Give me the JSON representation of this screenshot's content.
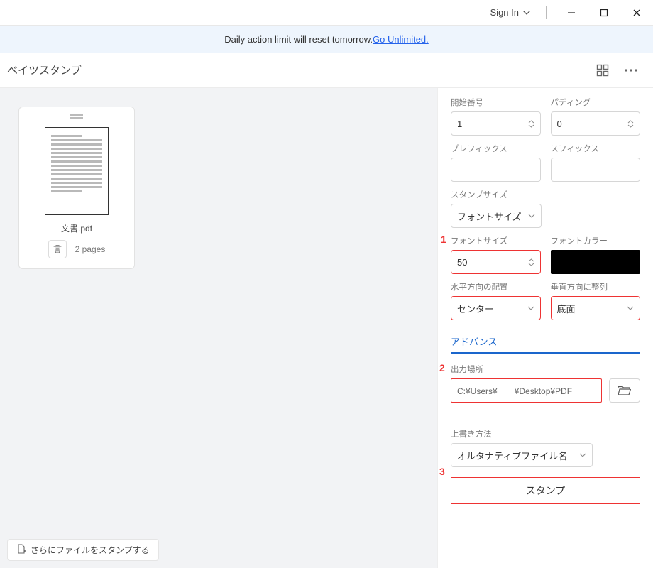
{
  "titlebar": {
    "signin": "Sign In"
  },
  "banner": {
    "text": "Daily action limit will reset tomorrow. ",
    "link": "Go Unlimited."
  },
  "header": {
    "title": "ベイツスタンプ"
  },
  "file": {
    "name": "文書.pdf",
    "pages": "2 pages"
  },
  "panel": {
    "start_number": {
      "label": "開始番号",
      "value": "1"
    },
    "padding": {
      "label": "パディング",
      "value": "0"
    },
    "prefix": {
      "label": "プレフィックス",
      "value": ""
    },
    "suffix": {
      "label": "スフィックス",
      "value": ""
    },
    "stamp_size": {
      "label": "スタンプサイズ",
      "value": "フォントサイズ"
    },
    "font_size": {
      "label": "フォントサイズ",
      "value": "50"
    },
    "font_color": {
      "label": "フォントカラー",
      "value": "#000000"
    },
    "halign": {
      "label": "水平方向の配置",
      "value": "センター"
    },
    "valign": {
      "label": "垂直方向に整列",
      "value": "底面"
    },
    "advance": "アドバンス",
    "output": {
      "label": "出力場所",
      "path": "C:¥Users¥　　¥Desktop¥PDF"
    },
    "overwrite": {
      "label": "上書き方法",
      "value": "オルタナティブファイル名"
    },
    "stamp_btn": "スタンプ"
  },
  "markers": {
    "m1": "1",
    "m2": "2",
    "m3": "3"
  },
  "footer": {
    "more_stamp": "さらにファイルをスタンプする"
  }
}
